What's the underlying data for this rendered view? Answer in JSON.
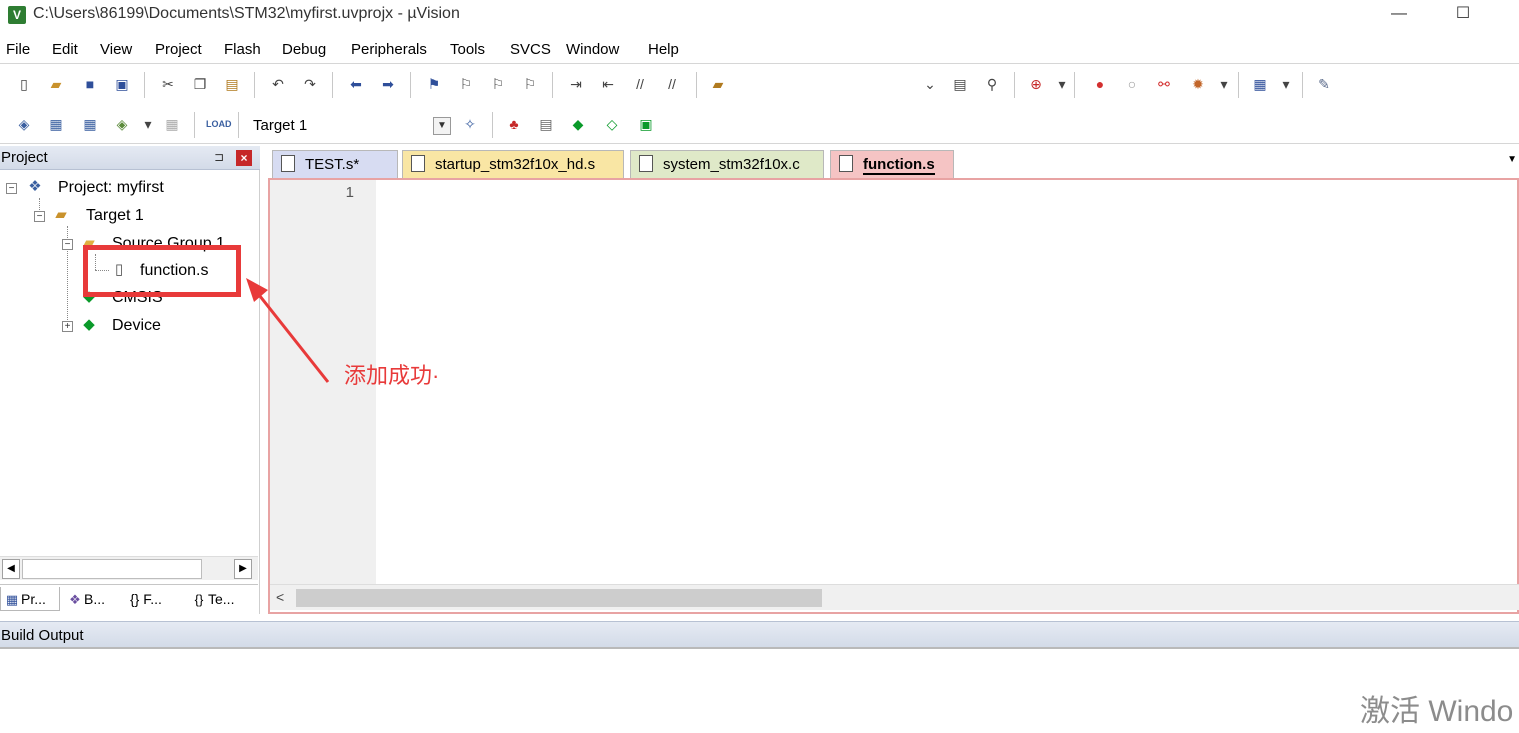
{
  "window": {
    "title": "C:\\Users\\86199\\Documents\\STM32\\myfirst.uvprojx - µVision",
    "app_icon": "V",
    "minimize_label": "—",
    "maximize_label": "☐"
  },
  "menu": [
    "File",
    "Edit",
    "View",
    "Project",
    "Flash",
    "Debug",
    "Peripherals",
    "Tools",
    "SVCS",
    "Window",
    "Help"
  ],
  "toolbar2": {
    "target": "Target 1"
  },
  "project_panel": {
    "title": "Project",
    "pin": "⊐",
    "close": "×",
    "tree": {
      "project": "Project: myfirst",
      "target": "Target 1",
      "source_group": "Source Group 1",
      "file": "function.s",
      "cmsis": "CMSIS",
      "device": "Device"
    },
    "tabs": [
      "Pr...",
      "B...",
      "{} F...",
      "Te..."
    ]
  },
  "editor": {
    "tabs": [
      {
        "label": "TEST.s*",
        "color": "#d7dcf2"
      },
      {
        "label": "startup_stm32f10x_hd.s",
        "color": "#f9e6a4"
      },
      {
        "label": "system_stm32f10x.c",
        "color": "#dfe9c8"
      },
      {
        "label": "function.s",
        "color": "#f5c4c4"
      }
    ],
    "active_tab": "function.s",
    "line_numbers": [
      "1"
    ]
  },
  "build_output": {
    "title": "Build Output"
  },
  "annotation": {
    "text": "添加成功·",
    "color": "#e83a3a"
  },
  "watermark": {
    "text": "激活 Windo"
  }
}
